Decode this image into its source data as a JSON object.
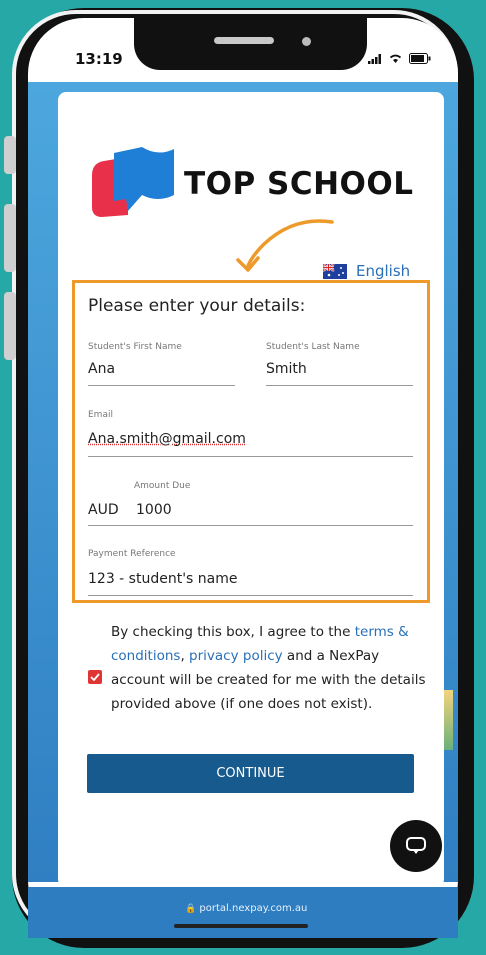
{
  "status_bar": {
    "time": "13:19"
  },
  "brand": {
    "name": "TOP SCHOOL"
  },
  "language": {
    "label": "English"
  },
  "form": {
    "heading": "Please enter your details:",
    "first_name": {
      "label": "Student's First Name",
      "value": "Ana"
    },
    "last_name": {
      "label": "Student's Last Name",
      "value": "Smith"
    },
    "email": {
      "label": "Email",
      "value": "Ana.smith@gmail.com"
    },
    "amount": {
      "label": "Amount Due",
      "currency": "AUD",
      "value": "1000"
    },
    "reference": {
      "label": "Payment Reference",
      "value": "123 - student's name"
    }
  },
  "agreement": {
    "text_before": "By checking this box, I agree to the ",
    "terms_link": "terms & conditions",
    "separator": ", ",
    "privacy_link": "privacy policy",
    "text_after": " and a NexPay account will be created for me with the details provided above (if one does not exist).",
    "checked": true
  },
  "continue_button": {
    "label": "CONTINUE"
  },
  "browser": {
    "url": "portal.nexpay.com.au"
  },
  "colors": {
    "background": "#26a9a6",
    "accent_border": "#ee9a2a",
    "button": "#165a8e",
    "link": "#2a70b8",
    "checkbox": "#e03535"
  },
  "icons": [
    "signal-icon",
    "wifi-icon",
    "battery-icon",
    "australia-flag-icon",
    "checkmark-icon",
    "chat-icon",
    "lock-icon",
    "arrow-annotation-icon"
  ]
}
